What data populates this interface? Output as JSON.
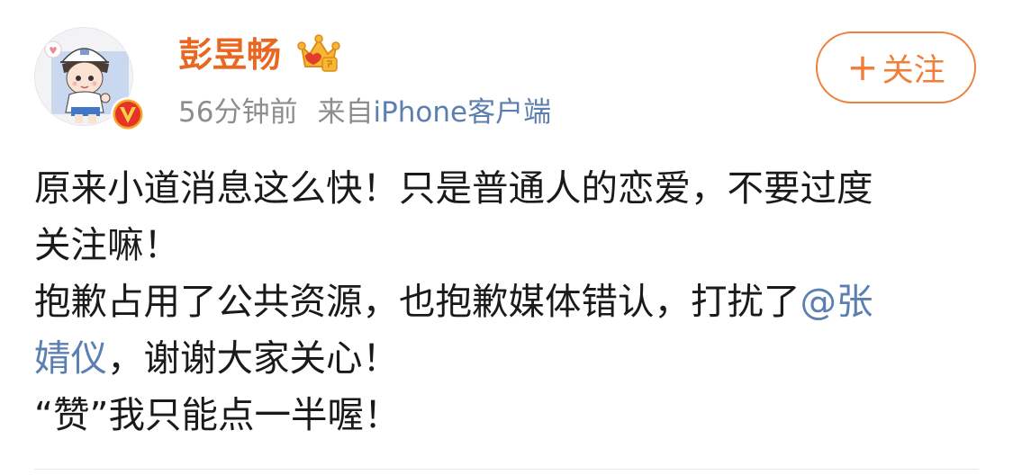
{
  "post": {
    "author": {
      "name": "彭昱畅",
      "avatar_icon": "cartoon-boy-avatar",
      "verified_icon": "v-badge-icon",
      "vip_icon": "crown-icon"
    },
    "time": "56分钟前",
    "source_prefix": "来自",
    "source_name": "iPhone客户端",
    "follow_button": {
      "plus": "+",
      "label": "关注"
    },
    "content": {
      "line1": "原来小道消息这么快！只是普通人的恋爱，不要过度",
      "line2": "关注嘛！",
      "line3_text": "抱歉占用了公共资源，也抱歉媒体错认，打扰了",
      "line3_mention": "@张",
      "line4_mention": "婧仪",
      "line4_text": "，谢谢大家关心！",
      "line5": "“赞”我只能点一半喔！"
    }
  },
  "colors": {
    "username": "#e86722",
    "follow_button": "#f07f3b",
    "link": "#5b7fb1",
    "meta": "#8d8d8d",
    "text": "#1a1a1a"
  }
}
